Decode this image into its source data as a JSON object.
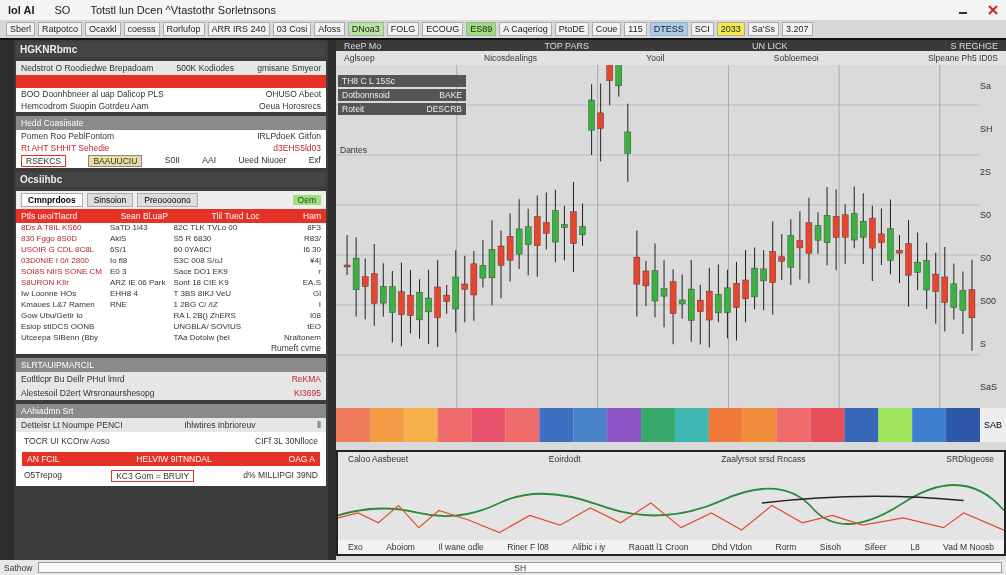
{
  "window": {
    "title_left": "lol  AI",
    "title_mid": "SO",
    "title": "Totstl lun Dcen ^Vtastothr Sorletnsons"
  },
  "toolbar": [
    {
      "label": "Sberl",
      "color": "#f2f2f2"
    },
    {
      "label": "Ratpotco",
      "color": "#f2f2f2"
    },
    {
      "label": "Ocaxkl",
      "color": "#f2f2f2"
    },
    {
      "label": "coesss",
      "color": "#f2f2f2"
    },
    {
      "label": "Rorlufop",
      "color": "#f2f2f2"
    },
    {
      "label": "ARR  IRS 240",
      "color": "#f2f2f2"
    },
    {
      "label": "03  Cosi",
      "color": "#f2f2f2"
    },
    {
      "label": "Afoss",
      "color": "#f2f2f2"
    },
    {
      "label": "DNoa3",
      "color": "#b8e6a0"
    },
    {
      "label": "FOLG",
      "color": "#f2f2f2"
    },
    {
      "label": "ECOUG",
      "color": "#f2f2f2"
    },
    {
      "label": "ES89",
      "color": "#9be07a"
    },
    {
      "label": "A Caqeriog",
      "color": "#f2f2f2"
    },
    {
      "label": "PtoDE",
      "color": "#f2f2f2"
    },
    {
      "label": "Coue",
      "color": "#f2f2f2"
    },
    {
      "label": "115",
      "color": "#f2f2f2"
    },
    {
      "label": "DTESS",
      "color": "#a9cdf2"
    },
    {
      "label": "SCI",
      "color": "#f2f2f2"
    },
    {
      "label": "2033",
      "color": "#f5ea4a"
    },
    {
      "label": "Sa'Ss",
      "color": "#f2f2f2"
    },
    {
      "label": "3.207",
      "color": "#f2f2f2"
    }
  ],
  "left": {
    "title": "HGKNRbmc",
    "summary": {
      "header": [
        "Nedstrot O Roodiedwe Brepadoam",
        "500K Kodiodes",
        "gmisane Smyeor"
      ],
      "rows": [
        [
          "BOO Doonhbneer al uap Dalicop PLS",
          "OHUSO Abeot"
        ],
        [
          "Hemcodrom Suopin  Gotrdeu Aam",
          "Oeua Horosrecs"
        ]
      ]
    },
    "section": {
      "title": "Hedd Coasiisate",
      "rows": [
        [
          "Pomen Roo PeblFontom",
          "IRLPdoeK Gitfon"
        ],
        [
          "Rt AHT SHHIT Sehedie",
          "d3EHS5ld03"
        ]
      ],
      "chips": [
        "RSEKCS",
        "BAAUUCIU"
      ],
      "stats": [
        "S0II",
        "AAI",
        "Ueed Niuoer",
        "Exf"
      ]
    },
    "orders": {
      "title": "Ocsiihbc",
      "tabs": [
        {
          "label": "Cmnprdoos",
          "selected": true
        },
        {
          "label": "Sinsoion",
          "selected": false
        },
        {
          "label": "Preooooono",
          "selected": false
        }
      ],
      "badge": "Oem",
      "header": [
        "Ptls ueoiTlacrd",
        "Sean Bl.uaP",
        "Tlil Tued Loc",
        "Ham"
      ],
      "rows": [
        [
          "8Ds  A T8IL  KS60",
          "SaTD 1l43",
          "82C  TLK TVLo 00",
          "8F3"
        ],
        [
          "830 Fggo  8S0D",
          "AkiS",
          "S5  R 6830",
          "R83/"
        ],
        [
          "USOIR G CDL  8C8L",
          "6S/1",
          "60  0YA6C!",
          "I6 30"
        ],
        [
          "03D0NIE I 0/I 2800",
          "Io fl8",
          "S3C 008 S/oJ",
          "¥4|"
        ],
        [
          "SOI8S NIIS  SONE CM",
          "E0 3",
          "Sace DO1 EK9",
          "r"
        ],
        [
          "S8URON KIIr",
          "ARZ IE 06 Park",
          "Sont 18 CIE K9",
          "EA.S"
        ],
        [
          "Iw Loonne HOs",
          "EHH8 4",
          "T 3BS 8IKJ VeU",
          "Gl"
        ],
        [
          "Kmaues L&7 Ramen",
          "RNE",
          "1 2BG C/ /IZ",
          "I"
        ],
        [
          "Gow Ubu/Getir Io",
          "",
          "RA L 2B() ZhERS",
          "I08"
        ],
        [
          "Esiop stIDCS OONB",
          "",
          "UNGBLA/ SOVIUS",
          "tEO"
        ],
        [
          "Utceepa SIBenn (Bby",
          "",
          "TAa Dotolw (bel",
          "Nraltonem"
        ]
      ],
      "footer": "Rumeft cvme"
    },
    "alerts": {
      "title": "SLRTAUIPMARCIL",
      "rows": [
        [
          "Eotltlcpr Bu Dellr PHuI lmrd",
          "ReKMA"
        ],
        [
          "Alestesoil D2ert Wrsronaurshesopg",
          "KI3695"
        ]
      ]
    },
    "ticket": {
      "title": "AAhiadmn Srt",
      "header": [
        "Detteisr Lt Noumpe PENCI",
        "Ihlwtires Inbrioreuv",
        "ll"
      ],
      "line": [
        "TOCR UI KCOrw Aoso",
        "CIFf 3L 30Nlloce"
      ],
      "bar": [
        "AN FCIL",
        "HELVIW 9ITNNDAL",
        "OAG A"
      ],
      "footer": [
        "O5Trepog",
        "KC3 Gom = BRUIY",
        "d% MILLIPGI 39ND"
      ]
    }
  },
  "chart": {
    "top": [
      "ReeP Mo",
      "TOP PARS",
      "UN LICK",
      "S REGHGE"
    ],
    "sub": [
      "Aglsoep",
      "Nicosdealings",
      "Yooil",
      "Sobloemeoi",
      "Slpeane Ph5 ID0S"
    ],
    "legend": [
      {
        "label": "TH8 C L 15Sc"
      },
      {
        "label": "Dotbonnsoid",
        "value": "BAKE"
      },
      {
        "label": "Roteit",
        "value": "DESCRB"
      }
    ],
    "note": "Dantes",
    "axis": [
      "Sa",
      "SH",
      "2S",
      "S0",
      "S0",
      "S00",
      "S",
      "SaS"
    ],
    "band_label": "SAB"
  },
  "lower": {
    "top": [
      "Caloo Aasbeuet",
      "Eoirdodt",
      "Zaalyrsot srsd Rncass",
      "SRDlogeose"
    ],
    "labels": [
      "Exo",
      "Aboiom",
      "Il wane odle",
      "Riner F l08",
      "Alibic i iy",
      "Raoatt l1 Croon",
      "Dhd Vtdon",
      "Rorm",
      "Sisoh",
      "Sifeer",
      "L8",
      "Vad M Noosb"
    ]
  },
  "status": {
    "label": "Sathow",
    "scroll": "SH"
  }
}
